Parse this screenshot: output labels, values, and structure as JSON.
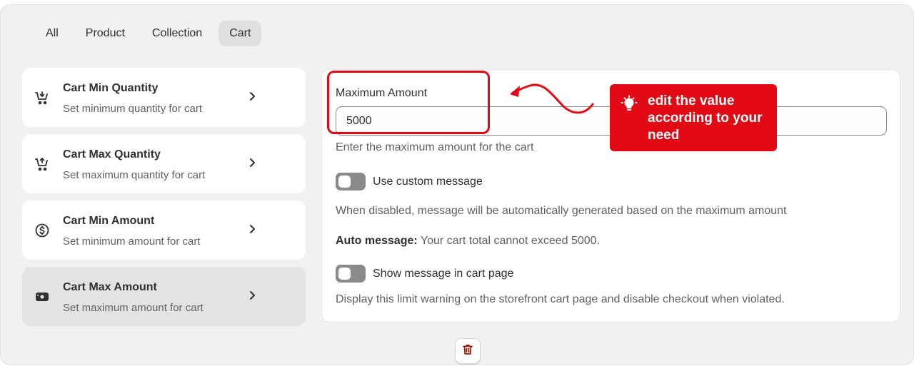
{
  "tabs": [
    {
      "label": "All"
    },
    {
      "label": "Product"
    },
    {
      "label": "Collection"
    },
    {
      "label": "Cart",
      "active": true
    }
  ],
  "rules": [
    {
      "title": "Cart Min Quantity",
      "subtitle": "Set minimum quantity for cart",
      "icon": "cart-down-icon"
    },
    {
      "title": "Cart Max Quantity",
      "subtitle": "Set maximum quantity for cart",
      "icon": "cart-up-icon"
    },
    {
      "title": "Cart Min Amount",
      "subtitle": "Set minimum amount for cart",
      "icon": "dollar-circle-icon"
    },
    {
      "title": "Cart Max Amount",
      "subtitle": "Set maximum amount for cart",
      "icon": "cash-icon",
      "selected": true
    }
  ],
  "form": {
    "label": "Maximum Amount",
    "value": "5000",
    "help": "Enter the maximum amount for the cart",
    "custom_message_toggle": {
      "label": "Use custom message",
      "on": false
    },
    "disabled_note": "When disabled, message will be automatically generated based on the maximum amount",
    "auto_message_label": "Auto message:",
    "auto_message_text": " Your cart total cannot exceed 5000.",
    "cart_page_toggle": {
      "label": "Show message in cart page",
      "on": false
    },
    "cart_page_help": "Display this limit warning on the storefront cart page and disable checkout when violated."
  },
  "callout": {
    "text": "edit the value according to your need",
    "icon": "lightbulb-icon"
  },
  "colors": {
    "accent_red": "#e00914",
    "background": "#f1f1f1",
    "card": "#ffffff",
    "selected_card": "#e3e3e3",
    "trash_icon": "#8e1f0b"
  },
  "footer": {
    "delete_icon": "trash-icon"
  }
}
